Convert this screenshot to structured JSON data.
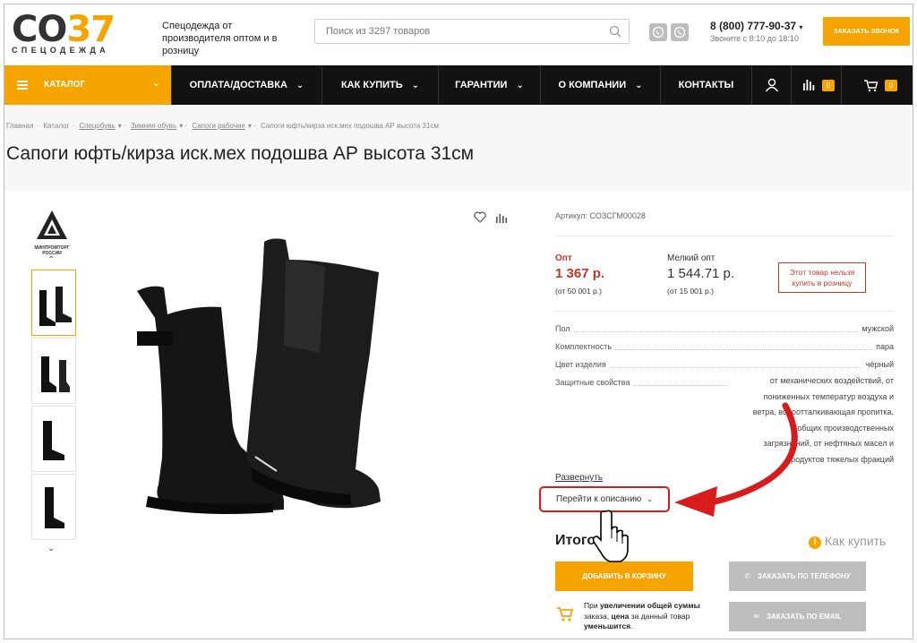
{
  "header": {
    "logo_main_a": "СО",
    "logo_main_b": "37",
    "logo_sub": "СПЕЦОДЕЖДА",
    "tagline": "Спецодежда от производителя оптом и в розницу",
    "search_placeholder": "Поиск из 3297 товаров",
    "phone": "8 (800) 777-90-37",
    "phone_note": "Звоните с 8:10 до 18:10",
    "callback_label": "Заказать звонок"
  },
  "nav": {
    "catalog": "Каталог",
    "items": [
      "Оплата/доставка",
      "Как купить",
      "Гарантии",
      "О компании",
      "Контакты"
    ],
    "compare_count": "0",
    "cart_count": "0"
  },
  "breadcrumb": [
    "Главная",
    "Каталог",
    "Спецобувь",
    "Зимняя обувь",
    "Сапоги рабочие",
    "Сапоги юфть/кирза иск.мех подошва АР высота 31см"
  ],
  "product": {
    "title": "Сапоги юфть/кирза иск.мех подошва АР высота 31см",
    "cert_label": "Минпромторг России",
    "sku": "Артикул: СОЗСГМ00028",
    "opt_label": "Опт",
    "opt_price": "1 367 р.",
    "opt_note": "(от 50 001 р.)",
    "small_label": "Мелкий опт",
    "small_price": "1 544.71 р.",
    "small_note": "(от 15 001 р.)",
    "retail_warning": "Этот товар нельзя купить в розницу",
    "specs": [
      {
        "k": "Пол",
        "v": "мужской"
      },
      {
        "k": "Комплектность",
        "v": "пара"
      },
      {
        "k": "Цвет изделия",
        "v": "чёрный"
      },
      {
        "k": "Защитные свойства",
        "v": ""
      }
    ],
    "protect_lines": [
      "от механических воздействий, от",
      "пониженных температур воздуха и",
      "ветра, водоотталкивающая пропитка,",
      "общих производственных",
      "загрязнений, от нефтяных масел и",
      "продуктов тяжелых фракций"
    ],
    "expand": "Развернуть",
    "goto_desc": "Перейти к описанию",
    "total": "Итого",
    "how_buy": "Как купить",
    "add_cart": "Добавить в корзину",
    "order_phone": "Заказать по телефону",
    "order_email": "Заказать по email",
    "hint_parts": [
      "При ",
      "увеличении общей суммы",
      " заказа, ",
      "цена",
      " за данный товар ",
      "уменьшится",
      "."
    ]
  },
  "colors": {
    "accent": "#f5a400",
    "nav_bg": "#121212",
    "alert": "#d81b1b"
  }
}
